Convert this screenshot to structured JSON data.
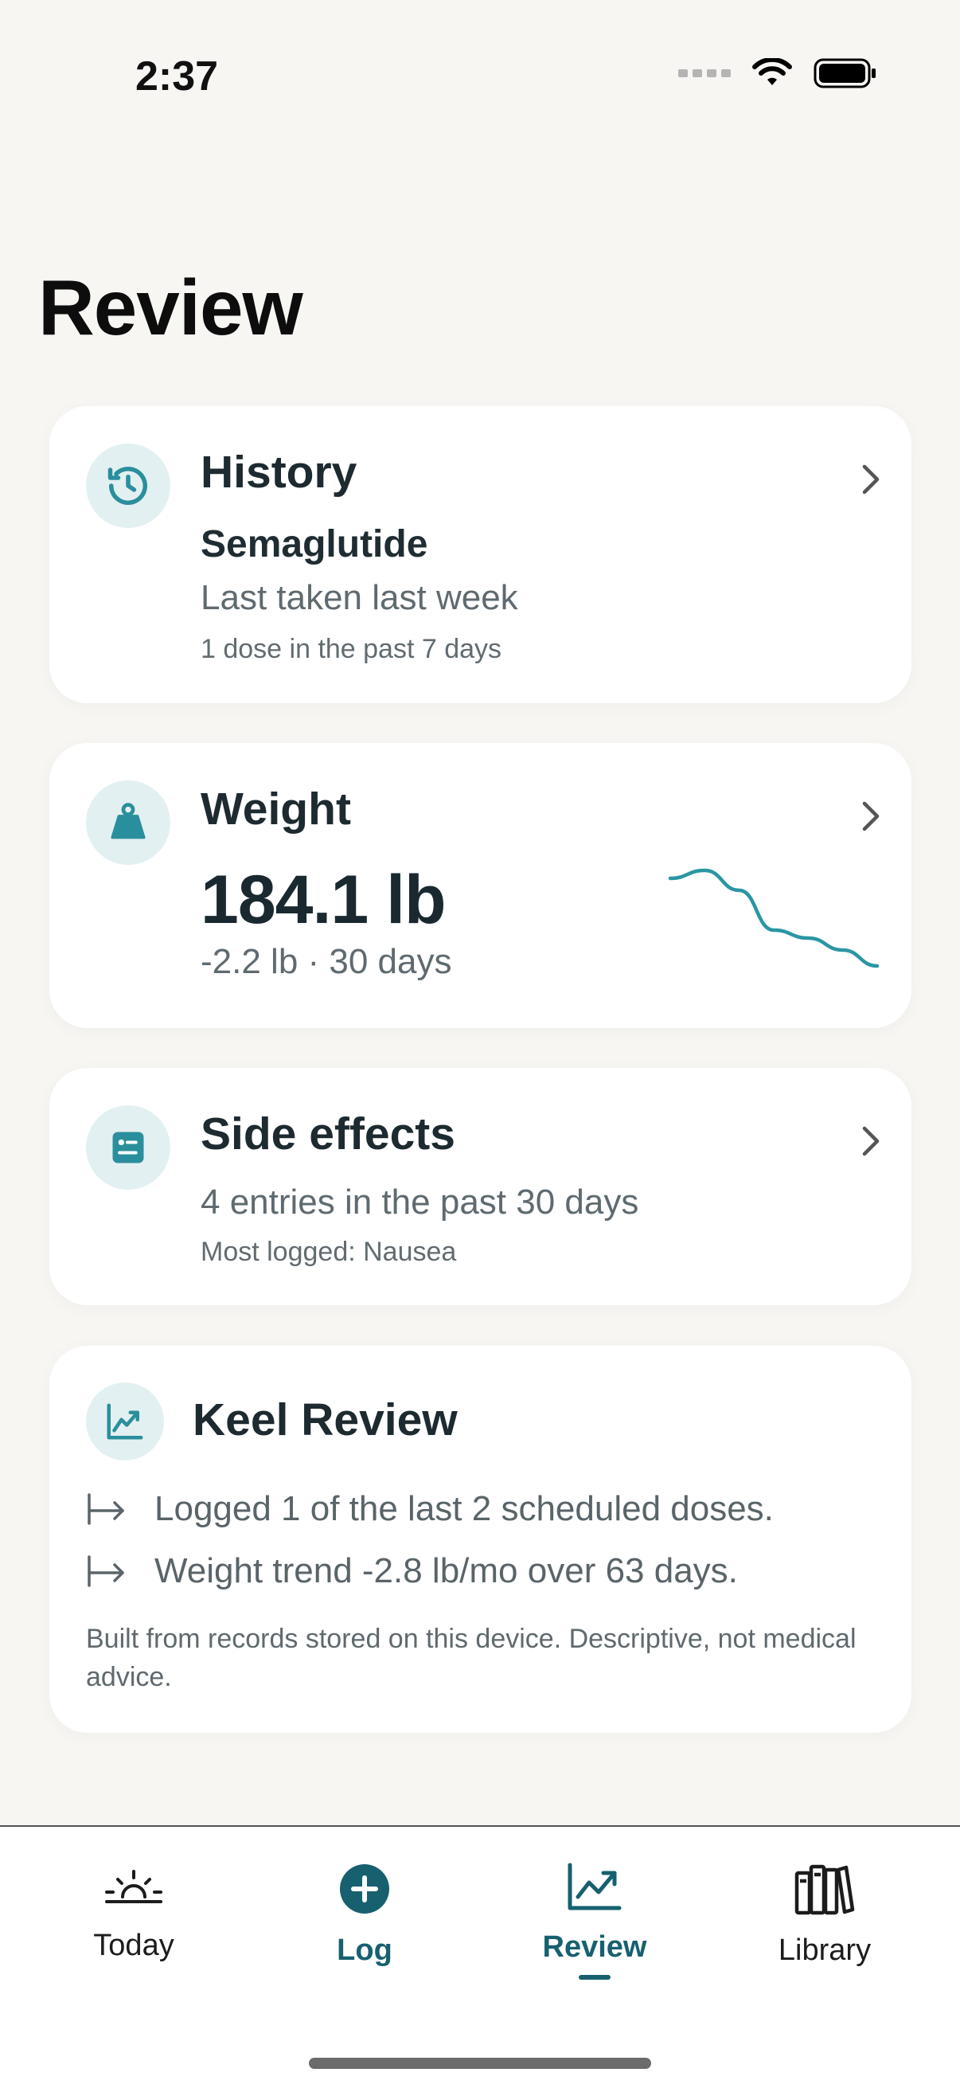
{
  "status_bar": {
    "time": "2:37"
  },
  "page": {
    "title": "Review"
  },
  "history": {
    "title": "History",
    "medication": "Semaglutide",
    "last_taken": "Last taken last week",
    "doses": "1 dose in the past 7 days"
  },
  "weight": {
    "title": "Weight",
    "value": "184.1 lb",
    "change": "-2.2 lb · 30 days",
    "sparkline": [
      186.3,
      186.5,
      186.0,
      185.0,
      184.8,
      184.5,
      184.1
    ],
    "line_color": "#2a96a3"
  },
  "side_effects": {
    "title": "Side effects",
    "entries": "4 entries in the past 30 days",
    "most_logged": "Most logged: Nausea"
  },
  "keel_review": {
    "title": "Keel Review",
    "bullets": [
      "Logged 1 of the last 2 scheduled doses.",
      "Weight trend -2.8 lb/mo over 63 days."
    ],
    "footnote": "Built from records stored on this device. Descriptive, not medical advice."
  },
  "tab_bar": {
    "active": "Review",
    "tabs": [
      {
        "label": "Today",
        "icon": "sunrise-icon"
      },
      {
        "label": "Log",
        "icon": "plus-circle-icon"
      },
      {
        "label": "Review",
        "icon": "chart-line-icon"
      },
      {
        "label": "Library",
        "icon": "books-icon"
      }
    ]
  },
  "colors": {
    "accent": "#17606f",
    "icon_bg": "#e3f0f1",
    "icon_fg": "#2a8f9c",
    "background": "#f7f6f3"
  }
}
